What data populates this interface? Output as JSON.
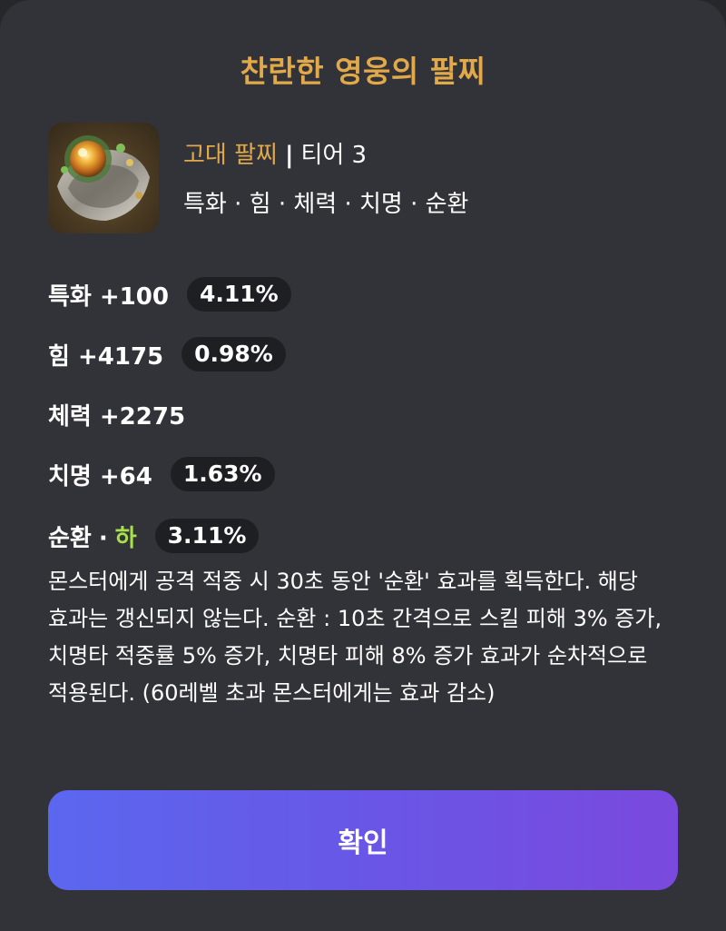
{
  "dialog": {
    "title": "찬란한 영웅의 팔찌",
    "item": {
      "icon": "bracelet-icon",
      "type": "고대 팔찌",
      "separator": "|",
      "tier": "티어 3",
      "effects_line": "특화 · 힘 · 체력 · 치명 · 순환"
    },
    "stats": [
      {
        "label": "특화 +100",
        "pill": "4.11%"
      },
      {
        "label": "힘 +4175",
        "pill": "0.98%"
      },
      {
        "label": "체력 +2275"
      },
      {
        "label": "치명 +64",
        "pill": "1.63%"
      }
    ],
    "special": {
      "name": "순환",
      "dot": "·",
      "grade": "하",
      "pill": "3.11%",
      "grade_color": "#a6e04a"
    },
    "description": "몬스터에게 공격 적중 시 30초 동안 '순환' 효과를 획득한다. 해당 효과는 갱신되지 않는다. 순환 : 10초 간격으로 스킬 피해 3% 증가, 치명타 적중률 5% 증가, 치명타 피해 8% 증가 효과가 순차적으로 적용된다. (60레벨 초과 몬스터에게는 효과 감소)",
    "confirm_label": "확인"
  },
  "colors": {
    "accent_title": "#e1a94a",
    "background": "#323338",
    "pill_background": "#1e1f22",
    "button_gradient_start": "#5b67ee",
    "button_gradient_end": "#7a49dd"
  }
}
